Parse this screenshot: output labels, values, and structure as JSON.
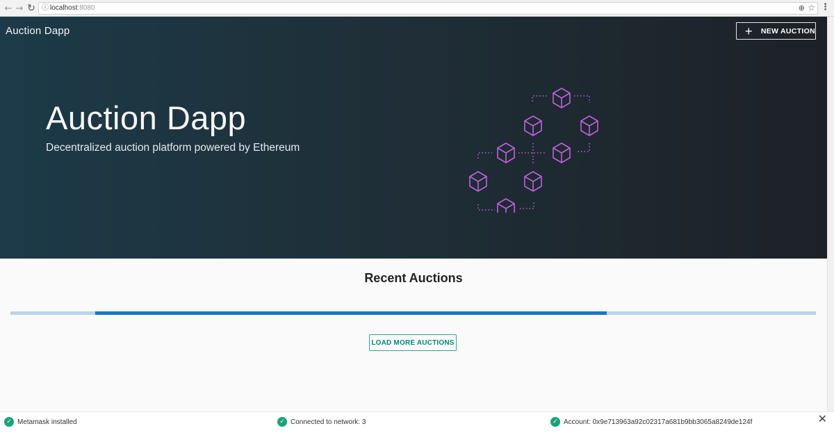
{
  "browser": {
    "url_host": "localhost",
    "url_port": ":8080",
    "icons": {
      "back": "arrow-left-icon",
      "forward": "arrow-right-icon",
      "reload": "reload-icon",
      "info": "info-icon",
      "zoom": "zoom-icon",
      "bookmark": "star-icon",
      "menu": "kebab-menu-icon"
    }
  },
  "header": {
    "brand": "Auction Dapp",
    "new_auction_label": "NEW AUCTION",
    "new_auction_icon": "plus-icon"
  },
  "hero": {
    "title": "Auction Dapp",
    "subtitle": "Decentralized auction platform powered by Ethereum",
    "illustration_icon": "blockchain-cubes-icon",
    "accent_color": "#c060e0"
  },
  "main": {
    "section_title": "Recent Auctions",
    "progress_fill_fraction": 0.635,
    "progress_offset_fraction": 0.105,
    "load_more_label": "LOAD MORE AUCTIONS"
  },
  "status_bar": {
    "items": [
      {
        "text": "Metamask installed",
        "icon": "check-circle-icon"
      },
      {
        "text": "Connected to network: 3",
        "icon": "check-circle-icon"
      },
      {
        "text": "Account: 0x9e713963a92c02317a681b9bb3065a8249de124f",
        "icon": "check-circle-icon"
      }
    ],
    "close_icon": "close-icon",
    "status_color": "#1ba27a"
  }
}
